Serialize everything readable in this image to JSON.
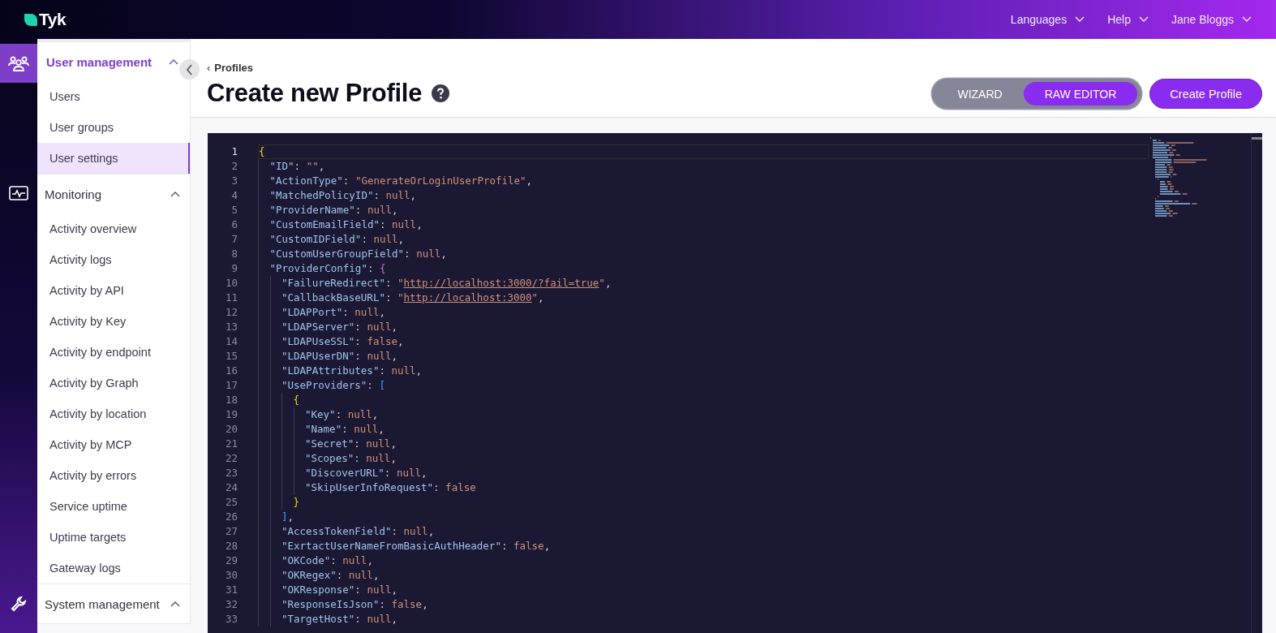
{
  "topbar": {
    "logo": "Tyk",
    "menus": [
      {
        "label": "Languages"
      },
      {
        "label": "Help"
      },
      {
        "label": "Jane Bloggs"
      }
    ]
  },
  "sidebar": {
    "sections": [
      {
        "title": "User management",
        "active": true,
        "expanded": true,
        "items": [
          {
            "label": "Users",
            "selected": false
          },
          {
            "label": "User groups",
            "selected": false
          },
          {
            "label": "User settings",
            "selected": true
          }
        ]
      },
      {
        "title": "Monitoring",
        "active": false,
        "expanded": true,
        "items": [
          {
            "label": "Activity overview",
            "selected": false
          },
          {
            "label": "Activity logs",
            "selected": false
          },
          {
            "label": "Activity by API",
            "selected": false
          },
          {
            "label": "Activity by Key",
            "selected": false
          },
          {
            "label": "Activity by endpoint",
            "selected": false
          },
          {
            "label": "Activity by Graph",
            "selected": false
          },
          {
            "label": "Activity by location",
            "selected": false
          },
          {
            "label": "Activity by MCP",
            "selected": false
          },
          {
            "label": "Activity by errors",
            "selected": false
          },
          {
            "label": "Service uptime",
            "selected": false
          },
          {
            "label": "Uptime targets",
            "selected": false
          },
          {
            "label": "Gateway logs",
            "selected": false
          }
        ]
      },
      {
        "title": "System management",
        "active": false,
        "expanded": true
      }
    ]
  },
  "page": {
    "breadcrumb_icon": "‹",
    "breadcrumb": "Profiles",
    "title": "Create new Profile",
    "mode_toggle": [
      {
        "label": "WIZARD",
        "selected": false
      },
      {
        "label": "RAW EDITOR",
        "selected": true
      }
    ],
    "primary_button": "Create Profile"
  },
  "editor": {
    "lines": [
      {
        "number": "1",
        "current": true,
        "tokens": [
          {
            "kind": "brace1",
            "text": "{"
          }
        ]
      },
      {
        "number": "2",
        "current": false,
        "tokens": [
          {
            "kind": "key",
            "text": "\"ID\""
          },
          {
            "kind": "punct",
            "text": ": "
          },
          {
            "kind": "string",
            "text": "\"\""
          },
          {
            "kind": "punct",
            "text": ","
          }
        ]
      },
      {
        "number": "3",
        "current": false,
        "tokens": [
          {
            "kind": "key",
            "text": "\"ActionType\""
          },
          {
            "kind": "punct",
            "text": ": "
          },
          {
            "kind": "string",
            "text": "\"GenerateOrLoginUserProfile\""
          },
          {
            "kind": "punct",
            "text": ","
          }
        ]
      },
      {
        "number": "4",
        "current": false,
        "tokens": [
          {
            "kind": "key",
            "text": "\"MatchedPolicyID\""
          },
          {
            "kind": "punct",
            "text": ": "
          },
          {
            "kind": "literal",
            "text": "null"
          },
          {
            "kind": "punct",
            "text": ","
          }
        ]
      },
      {
        "number": "5",
        "current": false,
        "tokens": [
          {
            "kind": "key",
            "text": "\"ProviderName\""
          },
          {
            "kind": "punct",
            "text": ": "
          },
          {
            "kind": "literal",
            "text": "null"
          },
          {
            "kind": "punct",
            "text": ","
          }
        ]
      },
      {
        "number": "6",
        "current": false,
        "tokens": [
          {
            "kind": "key",
            "text": "\"CustomEmailField\""
          },
          {
            "kind": "punct",
            "text": ": "
          },
          {
            "kind": "literal",
            "text": "null"
          },
          {
            "kind": "punct",
            "text": ","
          }
        ]
      },
      {
        "number": "7",
        "current": false,
        "tokens": [
          {
            "kind": "key",
            "text": "\"CustomIDField\""
          },
          {
            "kind": "punct",
            "text": ": "
          },
          {
            "kind": "literal",
            "text": "null"
          },
          {
            "kind": "punct",
            "text": ","
          }
        ]
      },
      {
        "number": "8",
        "current": false,
        "tokens": [
          {
            "kind": "key",
            "text": "\"CustomUserGroupField\""
          },
          {
            "kind": "punct",
            "text": ": "
          },
          {
            "kind": "literal",
            "text": "null"
          },
          {
            "kind": "punct",
            "text": ","
          }
        ]
      },
      {
        "number": "9",
        "current": false,
        "tokens": [
          {
            "kind": "key",
            "text": "\"ProviderConfig\""
          },
          {
            "kind": "punct",
            "text": ": "
          },
          {
            "kind": "brace2",
            "text": "{"
          }
        ]
      },
      {
        "number": "10",
        "current": false,
        "tokens": [
          {
            "kind": "key",
            "text": "\"FailureRedirect\""
          },
          {
            "kind": "punct",
            "text": ": "
          },
          {
            "kind": "string",
            "text": "\""
          },
          {
            "kind": "link",
            "text": "http://localhost:3000/?fail=true"
          },
          {
            "kind": "string",
            "text": "\""
          },
          {
            "kind": "punct",
            "text": ","
          }
        ]
      },
      {
        "number": "11",
        "current": false,
        "tokens": [
          {
            "kind": "key",
            "text": "\"CallbackBaseURL\""
          },
          {
            "kind": "punct",
            "text": ": "
          },
          {
            "kind": "string",
            "text": "\""
          },
          {
            "kind": "link",
            "text": "http://localhost:3000"
          },
          {
            "kind": "string",
            "text": "\""
          },
          {
            "kind": "punct",
            "text": ","
          }
        ]
      },
      {
        "number": "12",
        "current": false,
        "tokens": [
          {
            "kind": "key",
            "text": "\"LDAPPort\""
          },
          {
            "kind": "punct",
            "text": ": "
          },
          {
            "kind": "literal",
            "text": "null"
          },
          {
            "kind": "punct",
            "text": ","
          }
        ]
      },
      {
        "number": "13",
        "current": false,
        "tokens": [
          {
            "kind": "key",
            "text": "\"LDAPServer\""
          },
          {
            "kind": "punct",
            "text": ": "
          },
          {
            "kind": "literal",
            "text": "null"
          },
          {
            "kind": "punct",
            "text": ","
          }
        ]
      },
      {
        "number": "14",
        "current": false,
        "tokens": [
          {
            "kind": "key",
            "text": "\"LDAPUseSSL\""
          },
          {
            "kind": "punct",
            "text": ": "
          },
          {
            "kind": "literal",
            "text": "false"
          },
          {
            "kind": "punct",
            "text": ","
          }
        ]
      },
      {
        "number": "15",
        "current": false,
        "tokens": [
          {
            "kind": "key",
            "text": "\"LDAPUserDN\""
          },
          {
            "kind": "punct",
            "text": ": "
          },
          {
            "kind": "literal",
            "text": "null"
          },
          {
            "kind": "punct",
            "text": ","
          }
        ]
      },
      {
        "number": "16",
        "current": false,
        "tokens": [
          {
            "kind": "key",
            "text": "\"LDAPAttributes\""
          },
          {
            "kind": "punct",
            "text": ": "
          },
          {
            "kind": "literal",
            "text": "null"
          },
          {
            "kind": "punct",
            "text": ","
          }
        ]
      },
      {
        "number": "17",
        "current": false,
        "tokens": [
          {
            "kind": "key",
            "text": "\"UseProviders\""
          },
          {
            "kind": "punct",
            "text": ": "
          },
          {
            "kind": "brace3",
            "text": "["
          }
        ]
      },
      {
        "number": "18",
        "current": false,
        "tokens": [
          {
            "kind": "brace1",
            "text": "{"
          }
        ]
      },
      {
        "number": "19",
        "current": false,
        "tokens": [
          {
            "kind": "key",
            "text": "\"Key\""
          },
          {
            "kind": "punct",
            "text": ": "
          },
          {
            "kind": "literal",
            "text": "null"
          },
          {
            "kind": "punct",
            "text": ","
          }
        ]
      },
      {
        "number": "20",
        "current": false,
        "tokens": [
          {
            "kind": "key",
            "text": "\"Name\""
          },
          {
            "kind": "punct",
            "text": ": "
          },
          {
            "kind": "literal",
            "text": "null"
          },
          {
            "kind": "punct",
            "text": ","
          }
        ]
      },
      {
        "number": "21",
        "current": false,
        "tokens": [
          {
            "kind": "key",
            "text": "\"Secret\""
          },
          {
            "kind": "punct",
            "text": ": "
          },
          {
            "kind": "literal",
            "text": "null"
          },
          {
            "kind": "punct",
            "text": ","
          }
        ]
      },
      {
        "number": "22",
        "current": false,
        "tokens": [
          {
            "kind": "key",
            "text": "\"Scopes\""
          },
          {
            "kind": "punct",
            "text": ": "
          },
          {
            "kind": "literal",
            "text": "null"
          },
          {
            "kind": "punct",
            "text": ","
          }
        ]
      },
      {
        "number": "23",
        "current": false,
        "tokens": [
          {
            "kind": "key",
            "text": "\"DiscoverURL\""
          },
          {
            "kind": "punct",
            "text": ": "
          },
          {
            "kind": "literal",
            "text": "null"
          },
          {
            "kind": "punct",
            "text": ","
          }
        ]
      },
      {
        "number": "24",
        "current": false,
        "tokens": [
          {
            "kind": "key",
            "text": "\"SkipUserInfoRequest\""
          },
          {
            "kind": "punct",
            "text": ": "
          },
          {
            "kind": "literal",
            "text": "false"
          }
        ]
      },
      {
        "number": "25",
        "current": false,
        "tokens": [
          {
            "kind": "brace1",
            "text": "}"
          }
        ]
      },
      {
        "number": "26",
        "current": false,
        "tokens": [
          {
            "kind": "brace3",
            "text": "]"
          },
          {
            "kind": "punct",
            "text": ","
          }
        ]
      },
      {
        "number": "27",
        "current": false,
        "tokens": [
          {
            "kind": "key",
            "text": "\"AccessTokenField\""
          },
          {
            "kind": "punct",
            "text": ": "
          },
          {
            "kind": "literal",
            "text": "null"
          },
          {
            "kind": "punct",
            "text": ","
          }
        ]
      },
      {
        "number": "28",
        "current": false,
        "tokens": [
          {
            "kind": "key",
            "text": "\"ExrtactUserNameFromBasicAuthHeader\""
          },
          {
            "kind": "punct",
            "text": ": "
          },
          {
            "kind": "literal",
            "text": "false"
          },
          {
            "kind": "punct",
            "text": ","
          }
        ]
      },
      {
        "number": "29",
        "current": false,
        "tokens": [
          {
            "kind": "key",
            "text": "\"OKCode\""
          },
          {
            "kind": "punct",
            "text": ": "
          },
          {
            "kind": "literal",
            "text": "null"
          },
          {
            "kind": "punct",
            "text": ","
          }
        ]
      },
      {
        "number": "30",
        "current": false,
        "tokens": [
          {
            "kind": "key",
            "text": "\"OKRegex\""
          },
          {
            "kind": "punct",
            "text": ": "
          },
          {
            "kind": "literal",
            "text": "null"
          },
          {
            "kind": "punct",
            "text": ","
          }
        ]
      },
      {
        "number": "31",
        "current": false,
        "tokens": [
          {
            "kind": "key",
            "text": "\"OKResponse\""
          },
          {
            "kind": "punct",
            "text": ": "
          },
          {
            "kind": "literal",
            "text": "null"
          },
          {
            "kind": "punct",
            "text": ","
          }
        ]
      },
      {
        "number": "32",
        "current": false,
        "tokens": [
          {
            "kind": "key",
            "text": "\"ResponseIsJson\""
          },
          {
            "kind": "punct",
            "text": ": "
          },
          {
            "kind": "literal",
            "text": "false"
          },
          {
            "kind": "punct",
            "text": ","
          }
        ]
      },
      {
        "number": "33",
        "current": false,
        "tokens": [
          {
            "kind": "key",
            "text": "\"TargetHost\""
          },
          {
            "kind": "punct",
            "text": ": "
          },
          {
            "kind": "literal",
            "text": "null"
          },
          {
            "kind": "punct",
            "text": ","
          }
        ]
      }
    ]
  }
}
